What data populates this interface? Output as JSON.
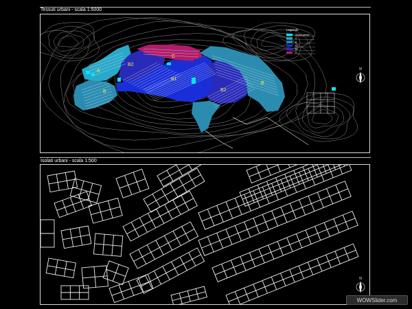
{
  "top_panel": {
    "caption": "Tessuti urbani - scala 1:5000",
    "legend": {
      "title": "Legenda",
      "items": [
        {
          "label": "Tessuti primari",
          "color": "#00e5ff"
        },
        {
          "label": "A",
          "color": "#2aa8c8"
        },
        {
          "label": "B",
          "color": "#2290b0"
        },
        {
          "label": "B1",
          "color": "#1a2ed8"
        },
        {
          "label": "B2",
          "color": "#2a2ab8"
        },
        {
          "label": "C",
          "color": "#b01c6a"
        }
      ]
    },
    "zone_labels": [
      "A",
      "B2",
      "C",
      "B1",
      "B2",
      "B",
      "B"
    ],
    "north_label": "N"
  },
  "bottom_panel": {
    "caption": "Isolati urbani - scala 1:500",
    "north_label": "N"
  },
  "watermark": "WOWSlider.com",
  "colors": {
    "background": "#000000",
    "frame": "#dddddd",
    "contour": "#9a9a9a",
    "zone_A": "#2aa8c8",
    "zone_B": "#2b8cb0",
    "zone_B1": "#1a2ed8",
    "zone_B2": "#2a2ab8",
    "zone_C": "#b01c6a",
    "primary": "#00e5ff",
    "label": "#ffe94a"
  }
}
